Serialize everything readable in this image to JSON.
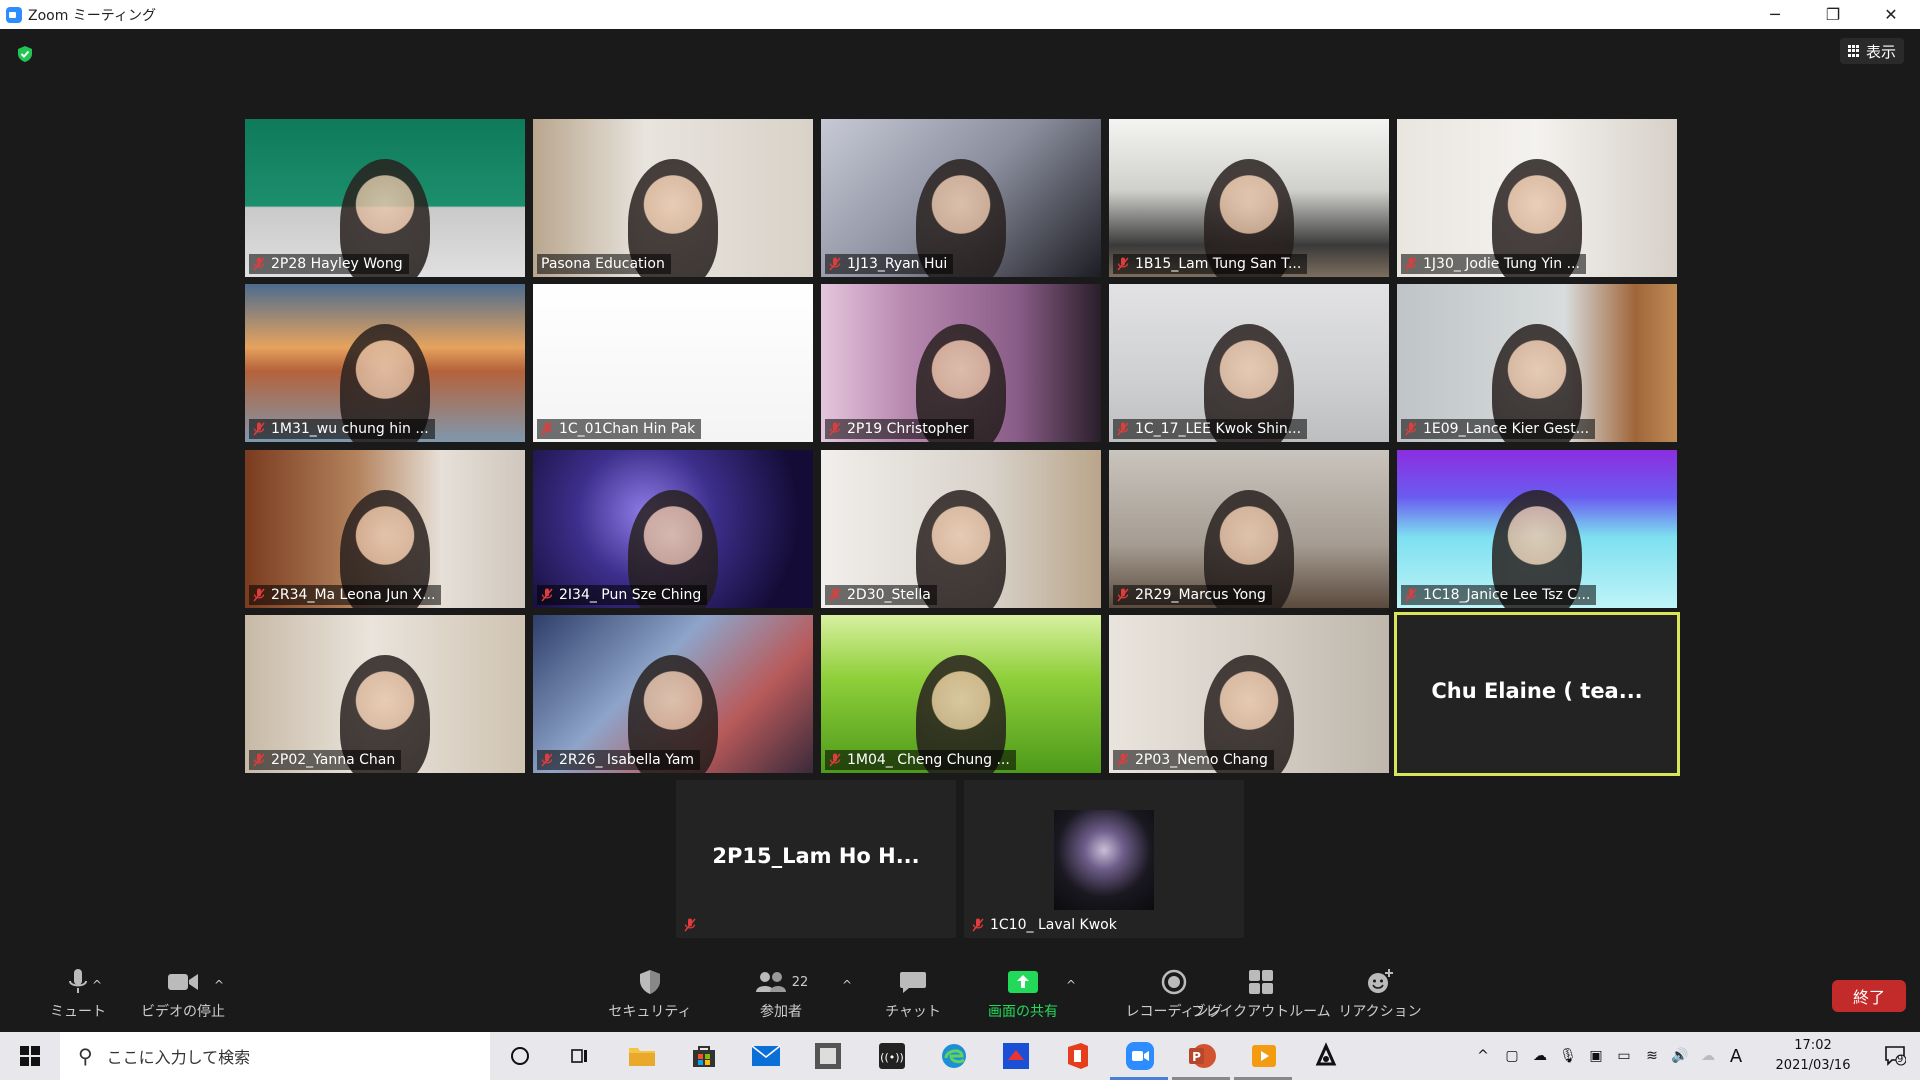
{
  "window": {
    "title": "Zoom ミーティング",
    "minimize": "─",
    "restore": "❐",
    "close": "✕"
  },
  "view_button": {
    "label": "表示"
  },
  "participants_grid": [
    {
      "name": "2P28 Hayley Wong",
      "muted": true
    },
    {
      "name": "Pasona Education",
      "muted": false
    },
    {
      "name": "1J13_Ryan Hui",
      "muted": true
    },
    {
      "name": "1B15_Lam Tung San T...",
      "muted": true
    },
    {
      "name": "1J30_ Jodie Tung Yin ...",
      "muted": true
    },
    {
      "name": "1M31_wu chung hin ...",
      "muted": true
    },
    {
      "name": "1C_01Chan Hin Pak",
      "muted": true
    },
    {
      "name": "2P19 Christopher",
      "muted": true
    },
    {
      "name": "1C_17_LEE Kwok Shin...",
      "muted": true
    },
    {
      "name": "1E09_Lance Kier Gest...",
      "muted": true
    },
    {
      "name": "2R34_Ma Leona Jun X...",
      "muted": true
    },
    {
      "name": "2I34_ Pun Sze Ching",
      "muted": true
    },
    {
      "name": "2D30_Stella",
      "muted": true
    },
    {
      "name": "2R29_Marcus Yong",
      "muted": true
    },
    {
      "name": "1C18_Janice Lee Tsz C...",
      "muted": true
    },
    {
      "name": "2P02_Yanna Chan",
      "muted": true
    },
    {
      "name": "2R26_ Isabella Yam",
      "muted": true
    },
    {
      "name": "1M04_ Cheng Chung ...",
      "muted": true
    },
    {
      "name": "2P03_Nemo Chang",
      "muted": true
    },
    {
      "name": "Chu  Elaine ( tea...",
      "muted": false,
      "video_off": true,
      "active_speaker": true
    }
  ],
  "participants_row2": [
    {
      "name": "2P15_Lam Ho H...",
      "muted": true,
      "video_off": true
    },
    {
      "name": "1C10_ Laval Kwok",
      "muted": true,
      "profile_picture": true
    }
  ],
  "toolbar": {
    "mute": "ミュート",
    "stop_video": "ビデオの停止",
    "security": "セキュリティ",
    "participants": "参加者",
    "participants_count": "22",
    "chat": "チャット",
    "share_screen": "画面の共有",
    "record": "レコーディング",
    "breakout": "ブレイクアウトルーム",
    "reactions": "リアクション",
    "end": "終了"
  },
  "taskbar": {
    "search_placeholder": "ここに入力して検索",
    "time": "17:02",
    "date": "2021/03/16",
    "ime": "A",
    "notifications_count": "9"
  },
  "colors": {
    "share_green": "#23d959",
    "end_red": "#c32a2a",
    "active_border": "#d9e65a"
  }
}
